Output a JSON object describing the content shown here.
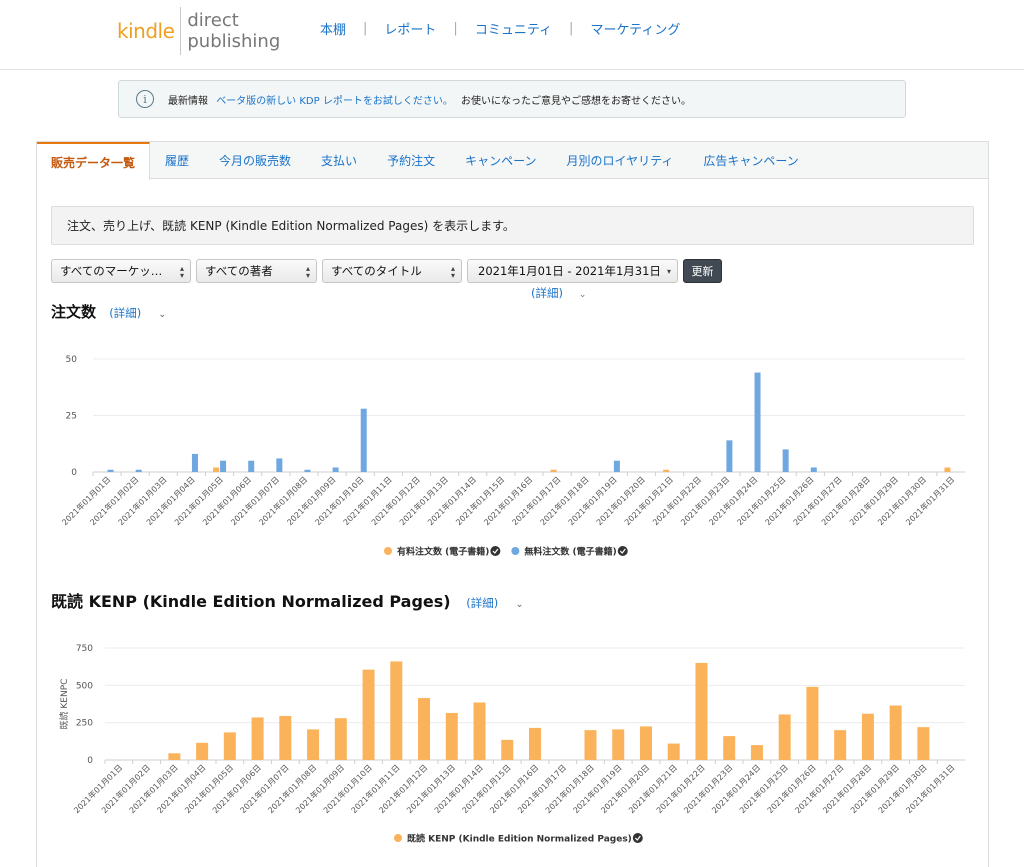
{
  "header": {
    "logo_kindle": "kindle",
    "logo_line1": "direct",
    "logo_line2": "publishing",
    "nav": [
      "本棚",
      "レポート",
      "コミュニティ",
      "マーケティング"
    ],
    "nav_sep": "|"
  },
  "banner": {
    "icon": "i",
    "prefix": "最新情報",
    "link": "ベータ版の新しい KDP レポートをお試しください。",
    "suffix": "お使いになったご意見やご感想をお寄せください。"
  },
  "tabs": [
    "販売データ一覧",
    "履歴",
    "今月の販売数",
    "支払い",
    "予約注文",
    "キャンペーン",
    "月別のロイヤリティ",
    "広告キャンペーン"
  ],
  "description": "注文、売り上げ、既読 KENP (Kindle Edition Normalized Pages) を表示します。",
  "filters": {
    "marketplace": "すべてのマーケッ…",
    "author": "すべての著者",
    "title": "すべてのタイトル",
    "date_range": "2021年1月01日 - 2021年1月31日",
    "update_button": "更新",
    "detail_link": "(詳細)"
  },
  "orders_section": {
    "heading": "注文数",
    "detail_link": "(詳細)"
  },
  "kenp_section": {
    "heading": "既読 KENP (Kindle Edition Normalized Pages)",
    "detail_link": "(詳細)"
  },
  "colors": {
    "accent": "#e47911",
    "link": "#1a73c8",
    "orange_bar": "#fbb35b",
    "blue_bar": "#6fa8e0"
  },
  "chart_data": [
    {
      "type": "bar",
      "categories": [
        "2021年01月01日",
        "2021年01月02日",
        "2021年01月03日",
        "2021年01月04日",
        "2021年01月05日",
        "2021年01月06日",
        "2021年01月07日",
        "2021年01月08日",
        "2021年01月09日",
        "2021年01月10日",
        "2021年01月11日",
        "2021年01月12日",
        "2021年01月13日",
        "2021年01月14日",
        "2021年01月15日",
        "2021年01月16日",
        "2021年01月17日",
        "2021年01月18日",
        "2021年01月19日",
        "2021年01月20日",
        "2021年01月21日",
        "2021年01月22日",
        "2021年01月23日",
        "2021年01月24日",
        "2021年01月25日",
        "2021年01月26日",
        "2021年01月27日",
        "2021年01月28日",
        "2021年01月29日",
        "2021年01月30日",
        "2021年01月31日"
      ],
      "series": [
        {
          "name": "有料注文数 (電子書籍)",
          "color": "#fbb35b",
          "values": [
            0,
            0,
            0,
            0,
            2,
            0,
            0,
            0,
            0,
            0,
            0,
            0,
            0,
            0,
            0,
            0,
            1,
            0,
            0,
            0,
            1,
            0,
            0,
            0,
            0,
            0,
            0,
            0,
            0,
            0,
            2
          ]
        },
        {
          "name": "無料注文数 (電子書籍)",
          "color": "#6fa8e0",
          "values": [
            1,
            1,
            0,
            8,
            5,
            5,
            6,
            1,
            2,
            28,
            0,
            0,
            0,
            0,
            0,
            0,
            0,
            0,
            5,
            0,
            0,
            0,
            14,
            44,
            10,
            2,
            0,
            0,
            0,
            0,
            0
          ]
        }
      ],
      "yticks": [
        0,
        25,
        50
      ],
      "ylim": [
        0,
        50
      ],
      "legend": "bottom",
      "grid": true
    },
    {
      "type": "bar",
      "categories": [
        "2021年01月01日",
        "2021年01月02日",
        "2021年01月03日",
        "2021年01月04日",
        "2021年01月05日",
        "2021年01月06日",
        "2021年01月07日",
        "2021年01月08日",
        "2021年01月09日",
        "2021年01月10日",
        "2021年01月11日",
        "2021年01月12日",
        "2021年01月13日",
        "2021年01月14日",
        "2021年01月15日",
        "2021年01月16日",
        "2021年01月17日",
        "2021年01月18日",
        "2021年01月19日",
        "2021年01月20日",
        "2021年01月21日",
        "2021年01月22日",
        "2021年01月23日",
        "2021年01月24日",
        "2021年01月25日",
        "2021年01月26日",
        "2021年01月27日",
        "2021年01月28日",
        "2021年01月29日",
        "2021年01月30日",
        "2021年01月31日"
      ],
      "series": [
        {
          "name": "既読 KENP (Kindle Edition Normalized Pages)",
          "color": "#fbb35b",
          "values": [
            0,
            0,
            45,
            115,
            185,
            285,
            295,
            205,
            280,
            605,
            660,
            415,
            315,
            385,
            135,
            215,
            0,
            200,
            205,
            225,
            110,
            650,
            160,
            100,
            305,
            490,
            200,
            310,
            365,
            220,
            0
          ]
        }
      ],
      "ylabel": "既読 KENPC",
      "yticks": [
        0,
        250,
        500,
        750
      ],
      "ylim": [
        0,
        750
      ],
      "legend": "bottom",
      "grid": true
    }
  ]
}
